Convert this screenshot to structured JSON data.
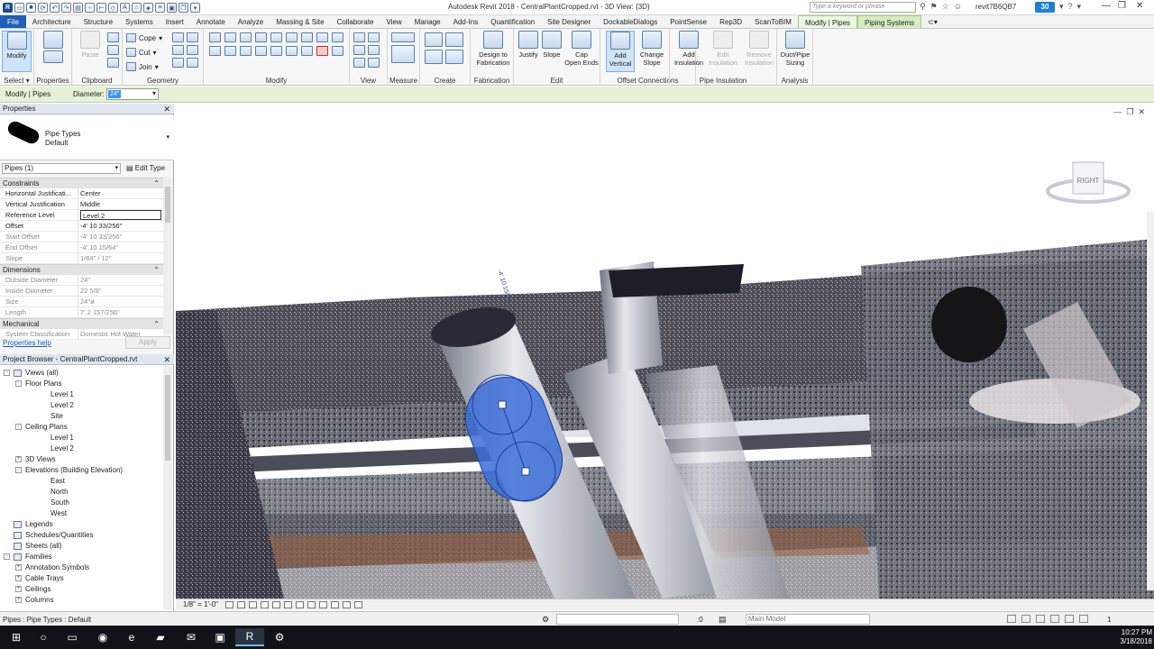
{
  "window": {
    "title": "Autodesk Revit 2018 -     CentralPlantCropped.rvt - 3D View: {3D}",
    "search_placeholder": "Type a keyword or phrase",
    "user": "revit7B6QB7",
    "notifications": "30",
    "logo_letter": "R"
  },
  "tabs": [
    "File",
    "Architecture",
    "Structure",
    "Systems",
    "Insert",
    "Annotate",
    "Analyze",
    "Massing & Site",
    "Collaborate",
    "View",
    "Manage",
    "Add-Ins",
    "Quantification",
    "Site Designer",
    "DockableDialogs",
    "PointSense",
    "Rep3D",
    "ScanToBIM",
    "Modify | Pipes",
    "Piping Systems"
  ],
  "ribbon": {
    "select": {
      "modify": "Modify",
      "title": "Select"
    },
    "properties": {
      "title": "Properties"
    },
    "clipboard": {
      "paste": "Paste",
      "title": "Clipboard"
    },
    "geometry": {
      "cope": "Cope",
      "cut": "Cut",
      "join": "Join",
      "title": "Geometry"
    },
    "modify": {
      "title": "Modify"
    },
    "view": {
      "title": "View"
    },
    "measure": {
      "title": "Measure"
    },
    "create": {
      "title": "Create"
    },
    "fabrication": {
      "design": "Design to\nFabrication",
      "title": "Fabrication"
    },
    "edit": {
      "justify": "Justify",
      "slope": "Slope",
      "cap": "Cap\nOpen Ends",
      "title": "Edit"
    },
    "offset": {
      "add_vertical": "Add\nVertical",
      "change_slope": "Change\nSlope",
      "title": "Offset Connections"
    },
    "insulation": {
      "add": "Add\nInsulation",
      "edit": "Edit\nInsulation",
      "remove": "Remove\nInsulation",
      "title": "Pipe Insulation"
    },
    "analysis": {
      "duct_pipe": "Duct/Pipe\nSizing",
      "title": "Analysis"
    }
  },
  "options_bar": {
    "context": "Modify | Pipes",
    "diameter_label": "Diameter:",
    "diameter_value": "24\""
  },
  "properties": {
    "title": "Properties",
    "type_family": "Pipe Types",
    "type_name": "Default",
    "instance_filter": "Pipes (1)",
    "edit_type": "Edit Type",
    "help": "Properties help",
    "apply": "Apply",
    "groups": [
      {
        "name": "Constraints",
        "rows": [
          {
            "k": "Horizontal Justificati...",
            "v": "Center",
            "ro": false
          },
          {
            "k": "Vertical Justification",
            "v": "Middle",
            "ro": false
          },
          {
            "k": "Reference Level",
            "v": "Level 2",
            "ro": false,
            "edit": true
          },
          {
            "k": "Offset",
            "v": "-4'  10 33/256\"",
            "ro": false
          },
          {
            "k": "Start Offset",
            "v": "-4'  10 33/256\"",
            "ro": true
          },
          {
            "k": "End Offset",
            "v": "-4'  10 15/64\"",
            "ro": true
          },
          {
            "k": "Slope",
            "v": "1/64\" / 12\"",
            "ro": true
          }
        ]
      },
      {
        "name": "Dimensions",
        "rows": [
          {
            "k": "Outside Diameter",
            "v": "24\"",
            "ro": true
          },
          {
            "k": "Inside Diameter",
            "v": "22 5/8\"",
            "ro": true
          },
          {
            "k": "Size",
            "v": "24\"ø",
            "ro": true
          },
          {
            "k": "Length",
            "v": "7'  2 157/256\"",
            "ro": true
          }
        ]
      },
      {
        "name": "Mechanical",
        "rows": [
          {
            "k": "System Classification",
            "v": "Domestic Hot Water",
            "ro": true
          }
        ]
      }
    ]
  },
  "browser": {
    "title": "Project Browser - CentralPlantCropped.rvt",
    "nodes": [
      {
        "label": "Views (all)",
        "level": 0,
        "toggle": "-",
        "icon": true
      },
      {
        "label": "Floor Plans",
        "level": 1,
        "toggle": "-"
      },
      {
        "label": "Level 1",
        "level": 2
      },
      {
        "label": "Level 2",
        "level": 2
      },
      {
        "label": "Site",
        "level": 2
      },
      {
        "label": "Ceiling Plans",
        "level": 1,
        "toggle": "-"
      },
      {
        "label": "Level 1",
        "level": 2
      },
      {
        "label": "Level 2",
        "level": 2
      },
      {
        "label": "3D Views",
        "level": 1,
        "toggle": "+"
      },
      {
        "label": "Elevations (Building Elevation)",
        "level": 1,
        "toggle": "-"
      },
      {
        "label": "East",
        "level": 2
      },
      {
        "label": "North",
        "level": 2
      },
      {
        "label": "South",
        "level": 2
      },
      {
        "label": "West",
        "level": 2
      },
      {
        "label": "Legends",
        "level": 0,
        "icon": true
      },
      {
        "label": "Schedules/Quantities",
        "level": 0,
        "icon": true
      },
      {
        "label": "Sheets (all)",
        "level": 0,
        "icon": true
      },
      {
        "label": "Families",
        "level": 0,
        "toggle": "-",
        "icon": true
      },
      {
        "label": "Annotation Symbols",
        "level": 1,
        "toggle": "+"
      },
      {
        "label": "Cable Trays",
        "level": 1,
        "toggle": "+"
      },
      {
        "label": "Ceilings",
        "level": 1,
        "toggle": "+"
      },
      {
        "label": "Columns",
        "level": 1,
        "toggle": "+"
      }
    ]
  },
  "viewport": {
    "viewcube_face": "RIGHT",
    "offset_label": "-4'  10 15/64\"",
    "accent": "#3b6fd8"
  },
  "viewbar": {
    "scale": "1/8\" = 1'-0\""
  },
  "status": {
    "text": "Pipes : Pipe Types : Default",
    "zero": ":0",
    "model": "Main Model",
    "filter": "1"
  },
  "taskbar": {
    "time": "10:27 PM",
    "date": "3/18/2018"
  }
}
